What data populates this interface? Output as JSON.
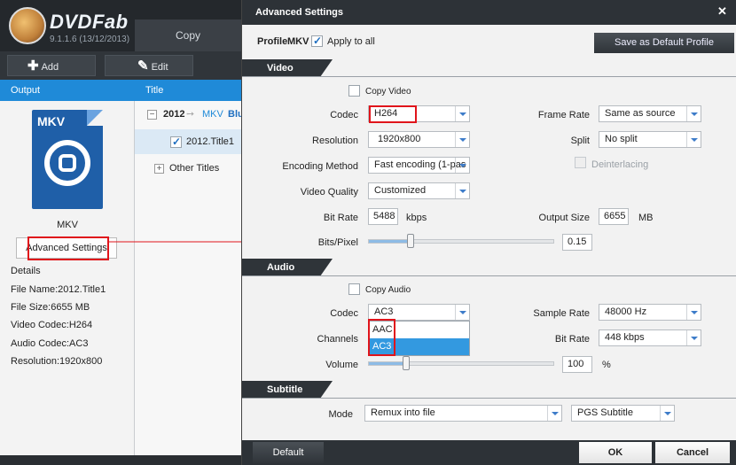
{
  "app": {
    "name": "DVDFab",
    "version": "9.1.1.6 (13/12/2013)",
    "copy_tab": "Copy",
    "add_label": "Add",
    "edit_label": "Edit",
    "col_output": "Output",
    "col_title": "Title",
    "output_format": "MKV",
    "mkv_icon_text": "MKV",
    "advanced_settings": "Advanced Settings",
    "details": {
      "heading": "Details",
      "file_name": "File Name:2012.Title1",
      "file_size": "File Size:6655 MB",
      "video_codec": "Video Codec:H264",
      "audio_codec": "Audio Codec:AC3",
      "resolution": "Resolution:1920x800"
    },
    "tree": {
      "root_title": "2012",
      "root_format": "MKV",
      "root_extra": "Blu",
      "selected_title": "2012.Title1",
      "other_titles": "Other Titles"
    }
  },
  "dialog": {
    "title": "Advanced Settings",
    "profile_label": "Profile",
    "profile_value": "MKV",
    "apply_to_all": "Apply to all",
    "save_default_profile": "Save as Default Profile",
    "video": {
      "section": "Video",
      "copy_video": "Copy Video",
      "codec_label": "Codec",
      "codec_value": "H264",
      "resolution_label": "Resolution",
      "resolution_value": "1920x800",
      "encoding_method_label": "Encoding Method",
      "encoding_method_value": "Fast encoding (1-pas",
      "video_quality_label": "Video Quality",
      "video_quality_value": "Customized",
      "bit_rate_label": "Bit Rate",
      "bit_rate_value": "5488",
      "bit_rate_unit": "kbps",
      "bits_pixel_label": "Bits/Pixel",
      "bits_pixel_value": "0.15",
      "frame_rate_label": "Frame Rate",
      "frame_rate_value": "Same as source",
      "split_label": "Split",
      "split_value": "No split",
      "deinterlacing_label": "Deinterlacing",
      "output_size_label": "Output Size",
      "output_size_value": "6655",
      "output_size_unit": "MB"
    },
    "audio": {
      "section": "Audio",
      "copy_audio": "Copy Audio",
      "codec_label": "Codec",
      "codec_value": "AC3",
      "codec_options": [
        "AAC",
        "AC3"
      ],
      "channels_label": "Channels",
      "volume_label": "Volume",
      "volume_value": "100",
      "volume_unit": "%",
      "sample_rate_label": "Sample Rate",
      "sample_rate_value": "48000 Hz",
      "bit_rate_label": "Bit Rate",
      "bit_rate_value": "448 kbps"
    },
    "subtitle": {
      "section": "Subtitle",
      "mode_label": "Mode",
      "mode_value": "Remux into file",
      "format_value": "PGS Subtitle"
    },
    "footer": {
      "default": "Default",
      "ok": "OK",
      "cancel": "Cancel"
    }
  },
  "colors": {
    "accent_blue": "#1f8ad8",
    "highlight_red": "#e0141b",
    "dialog_dark": "#2d3237"
  }
}
